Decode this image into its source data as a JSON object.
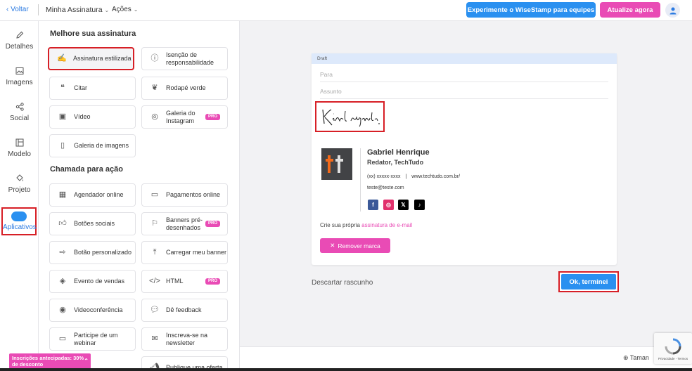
{
  "topbar": {
    "back_label": "Voltar",
    "menu_signature": "Minha Assinatura",
    "menu_actions": "Ações",
    "try_teams_button": "Experimente o WiseStamp para equipes",
    "upgrade_button": "Atualize agora",
    "accent_blue": "#2a90f0",
    "accent_pink": "#e94bb5"
  },
  "sidebar": {
    "items": [
      {
        "label": "Detalhes",
        "icon": "pencil-icon"
      },
      {
        "label": "Imagens",
        "icon": "image-icon"
      },
      {
        "label": "Social",
        "icon": "share-icon"
      },
      {
        "label": "Modelo",
        "icon": "template-icon"
      },
      {
        "label": "Projeto",
        "icon": "paint-bucket-icon"
      },
      {
        "label": "Aplicativos",
        "icon": "apps-icon",
        "active": true
      }
    ]
  },
  "panel": {
    "section1_title": "Melhore sua assinatura",
    "section2_title": "Chamada para ação",
    "apps": [
      {
        "label": "Assinatura estilizada",
        "icon": "signature-icon",
        "selected": true
      },
      {
        "label": "Isenção de responsabilidade",
        "icon": "info-icon"
      },
      {
        "label": "Citar",
        "icon": "quote-icon"
      },
      {
        "label": "Rodapé verde",
        "icon": "leaf-icon"
      },
      {
        "label": "Vídeo",
        "icon": "video-icon"
      },
      {
        "label": "Galeria do Instagram",
        "icon": "instagram-icon",
        "pro": "PRÓ"
      },
      {
        "label": "Galeria de imagens",
        "icon": "gallery-icon"
      }
    ],
    "cta": [
      {
        "label": "Agendador online",
        "icon": "calendar-icon"
      },
      {
        "label": "Pagamentos online",
        "icon": "credit-card-icon"
      },
      {
        "label": "Botões sociais",
        "icon": "thumbs-up-icon"
      },
      {
        "label": "Banners pré-desenhados",
        "icon": "flag-icon",
        "pro": "PRÓ"
      },
      {
        "label": "Botão personalizado",
        "icon": "button-click-icon"
      },
      {
        "label": "Carregar meu banner",
        "icon": "upload-icon"
      },
      {
        "label": "Evento de vendas",
        "icon": "tag-icon"
      },
      {
        "label": "HTML",
        "icon": "code-icon",
        "pro": "PRÓ"
      },
      {
        "label": "Videoconferência",
        "icon": "webcam-icon"
      },
      {
        "label": "Dê feedback",
        "icon": "feedback-icon"
      },
      {
        "label": "Participe de um webinar",
        "icon": "monitor-icon"
      },
      {
        "label": "Inscreva-se na newsletter",
        "icon": "envelope-icon"
      },
      {
        "label": "Publique uma oferta",
        "icon": "megaphone-icon"
      }
    ]
  },
  "email": {
    "draft_label": "Draft",
    "to_placeholder": "Para",
    "subject_placeholder": "Assunto",
    "closing_script": "Kind regards.",
    "name": "Gabriel Henrique",
    "role": "Redator,  TechTudo",
    "phone": "(xx) xxxxx-xxxx",
    "website": "www.techtudo.com.br/",
    "email": "teste@teste.com",
    "create_text": "Crie sua própria",
    "create_link": "assinatura de e-mail",
    "remove_button": "Remover marca",
    "social": [
      {
        "icon": "facebook-icon",
        "color": "#3b5998"
      },
      {
        "icon": "instagram-icon",
        "color": "#e1306c"
      },
      {
        "icon": "x-icon",
        "color": "#000000"
      },
      {
        "icon": "tiktok-icon",
        "color": "#000000"
      }
    ]
  },
  "actions": {
    "discard": "Descartar rascunho",
    "ok": "Ok, terminei"
  },
  "footer": {
    "zoom_label": "Taman",
    "recaptcha_text": "Privacidade - Termos",
    "promo_text": "Inscrições antecipadas: 30% de desconto"
  }
}
